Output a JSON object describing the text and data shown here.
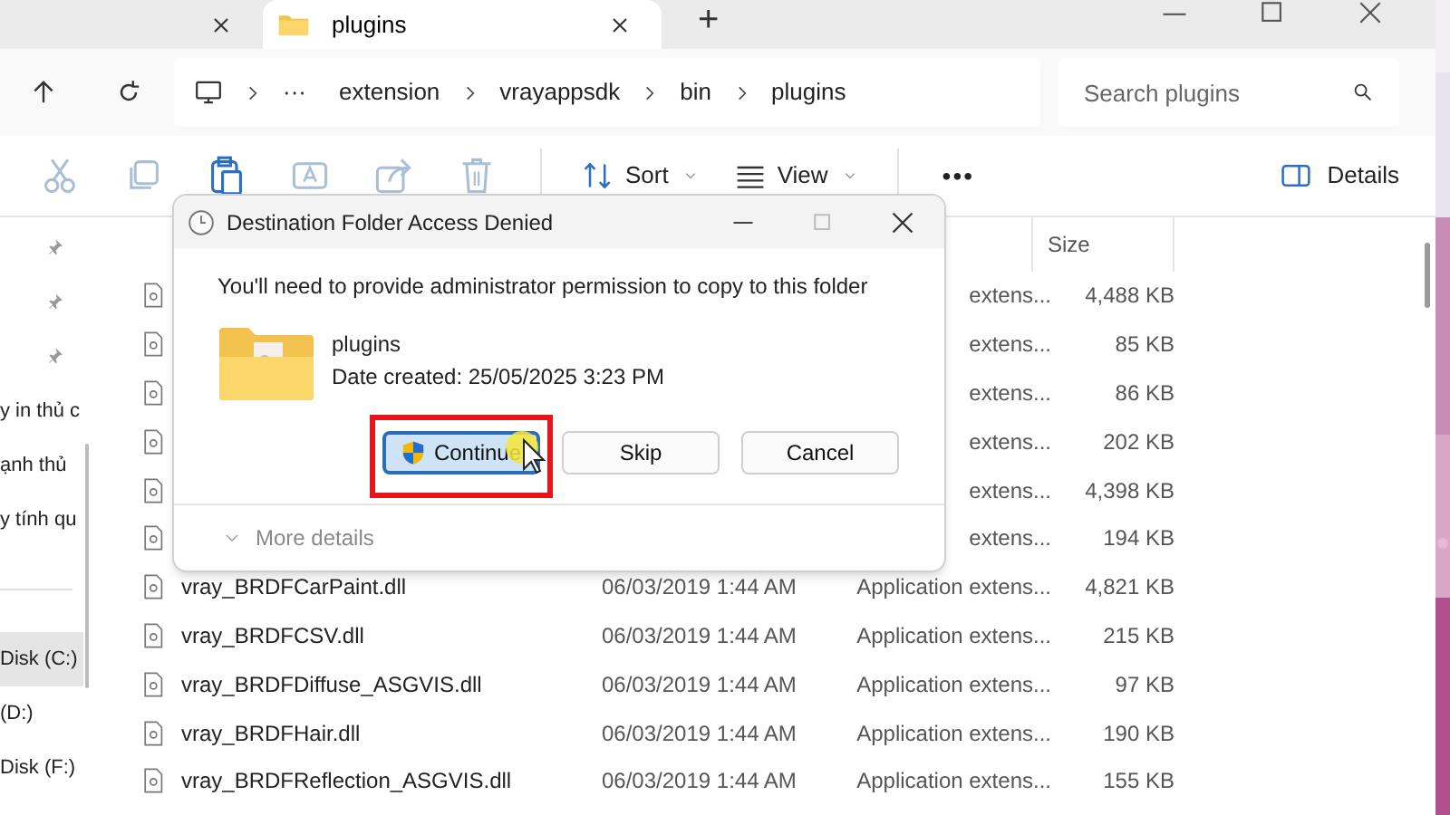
{
  "tabs": [
    {
      "selected": false
    },
    {
      "label": "plugins",
      "selected": true
    }
  ],
  "new_tab": "+",
  "breadcrumb": {
    "overflow": "···",
    "items": [
      "extension",
      "vrayappsdk",
      "bin",
      "plugins"
    ]
  },
  "search": {
    "placeholder": "Search plugins"
  },
  "commands": [
    {
      "kind": "cut",
      "disabled": true
    },
    {
      "kind": "copy",
      "disabled": true
    },
    {
      "kind": "paste",
      "disabled": false
    },
    {
      "kind": "rename",
      "disabled": true
    },
    {
      "kind": "share",
      "disabled": true
    },
    {
      "kind": "delete",
      "disabled": true
    },
    {
      "kind": "sort",
      "label": "Sort",
      "disabled": false
    },
    {
      "kind": "view",
      "label": "View",
      "disabled": false
    },
    {
      "kind": "more",
      "label": "•••",
      "disabled": false
    }
  ],
  "details_button": "Details",
  "sidebar": {
    "items": [
      {
        "pinned": true,
        "selected": false
      },
      {
        "pinned": true,
        "selected": false
      },
      {
        "pinned": true,
        "selected": false
      },
      {
        "label": "y in thủ c",
        "pinned": false,
        "selected": false
      },
      {
        "label": "ạnh thủ",
        "pinned": false,
        "selected": false
      },
      {
        "label": "y tính qu",
        "pinned": false,
        "selected": false
      },
      {
        "label": "Disk (C:)",
        "pinned": false,
        "selected": true
      },
      {
        "label": "(D:)",
        "pinned": false,
        "selected": false
      },
      {
        "label": "Disk (F:)",
        "pinned": false,
        "selected": false
      }
    ]
  },
  "file_list": {
    "columns": [
      "Size"
    ],
    "rows": [
      {
        "type": "extens...",
        "size": "4,488 KB"
      },
      {
        "type": "extens...",
        "size": "85 KB"
      },
      {
        "type": "extens...",
        "size": "86 KB"
      },
      {
        "type": "extens...",
        "size": "202 KB"
      },
      {
        "type": "extens...",
        "size": "4,398 KB"
      },
      {
        "type": "extens...",
        "size": "194 KB"
      },
      {
        "name": "vray_BRDFCarPaint.dll",
        "date": "06/03/2019 1:44 AM",
        "type": "Application extens...",
        "size": "4,821 KB"
      },
      {
        "name": "vray_BRDFCSV.dll",
        "date": "06/03/2019 1:44 AM",
        "type": "Application extens...",
        "size": "215 KB"
      },
      {
        "name": "vray_BRDFDiffuse_ASGVIS.dll",
        "date": "06/03/2019 1:44 AM",
        "type": "Application extens...",
        "size": "97 KB"
      },
      {
        "name": "vray_BRDFHair.dll",
        "date": "06/03/2019 1:44 AM",
        "type": "Application extens...",
        "size": "190 KB"
      },
      {
        "name": "vray_BRDFReflection_ASGVIS.dll",
        "date": "06/03/2019 1:44 AM",
        "type": "Application extens...",
        "size": "155 KB"
      }
    ]
  },
  "dialog": {
    "title": "Destination Folder Access Denied",
    "message": "You'll need to provide administrator permission to copy to this folder",
    "folder_name": "plugins",
    "date_created": "Date created: 25/05/2025 3:23 PM",
    "buttons": [
      {
        "label": "Continue",
        "kind": "shield",
        "selected": true,
        "highlighted": true
      },
      {
        "label": "Skip",
        "kind": "plain",
        "selected": false,
        "highlighted": false
      },
      {
        "label": "Cancel",
        "kind": "plain",
        "selected": false,
        "highlighted": false
      }
    ],
    "more_details": "More details"
  }
}
